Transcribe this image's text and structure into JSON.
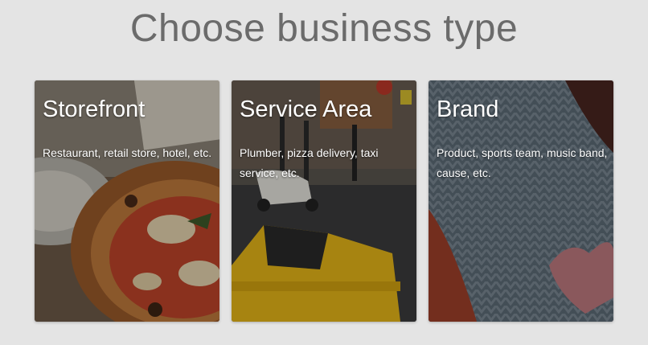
{
  "page": {
    "title": "Choose business type"
  },
  "cards": [
    {
      "title": "Storefront",
      "description": "Restaurant, retail store, hotel, etc.",
      "image_icon": "pizza-photo"
    },
    {
      "title": "Service Area",
      "description": "Plumber, pizza delivery, taxi service, etc.",
      "image_icon": "taxi-street-photo"
    },
    {
      "title": "Brand",
      "description": "Product, sports team, music band, cause, etc.",
      "image_icon": "knitted-sweater-photo"
    }
  ],
  "colors": {
    "background": "#e4e4e4",
    "title": "#6b6b6b",
    "card_text": "#ffffff"
  }
}
